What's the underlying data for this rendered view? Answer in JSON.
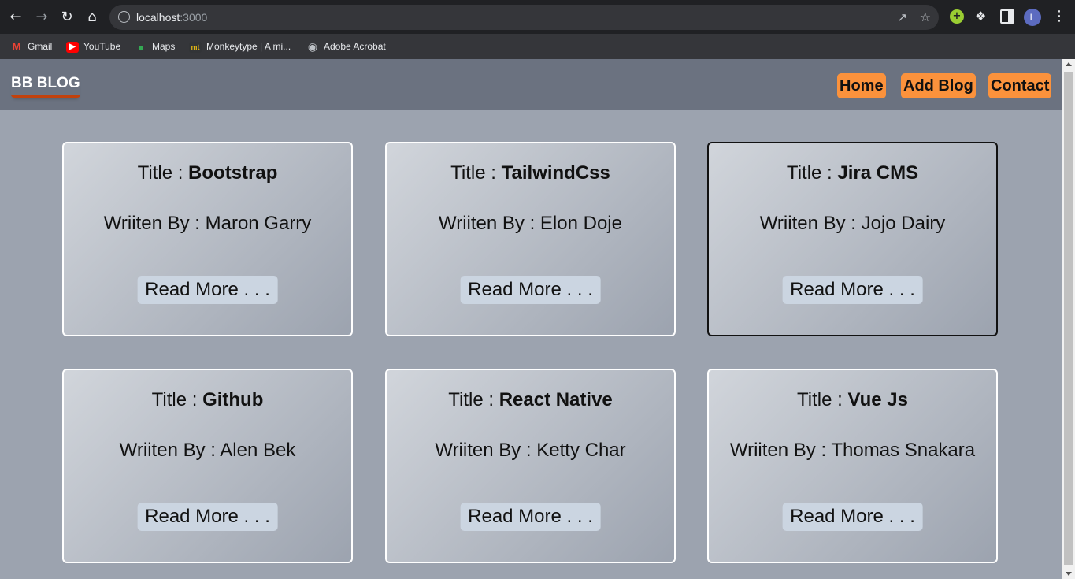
{
  "browser": {
    "url_host": "localhost",
    "url_port": ":3000",
    "avatar_letter": "L",
    "bookmarks": [
      "Gmail",
      "YouTube",
      "Maps",
      "Monkeytype | A mi...",
      "Adobe Acrobat"
    ]
  },
  "navbar": {
    "brand": "BB BLOG",
    "links": [
      "Home",
      "Add Blog",
      "Contact"
    ]
  },
  "blogs": [
    {
      "title_prefix": "Title : ",
      "title": "Bootstrap",
      "author": "Wriiten By : Maron Garry",
      "read_more": "Read More . . ."
    },
    {
      "title_prefix": "Title : ",
      "title": "TailwindCss",
      "author": "Wriiten By : Elon Doje",
      "read_more": "Read More . . ."
    },
    {
      "title_prefix": "Title : ",
      "title": "Jira CMS",
      "author": "Wriiten By : Jojo Dairy",
      "read_more": "Read More . . ."
    },
    {
      "title_prefix": "Title : ",
      "title": "Github",
      "author": "Wriiten By : Alen Bek",
      "read_more": "Read More . . ."
    },
    {
      "title_prefix": "Title : ",
      "title": "React Native",
      "author": "Wriiten By : Ketty Char",
      "read_more": "Read More . . ."
    },
    {
      "title_prefix": "Title : ",
      "title": "Vue Js",
      "author": "Wriiten By : Thomas Snakara",
      "read_more": "Read More . . ."
    }
  ],
  "colors": {
    "navbar_bg": "#6b7280",
    "page_bg": "#9ca3af",
    "nav_button": "#fb923c",
    "read_more_bg": "#cbd5e1"
  }
}
